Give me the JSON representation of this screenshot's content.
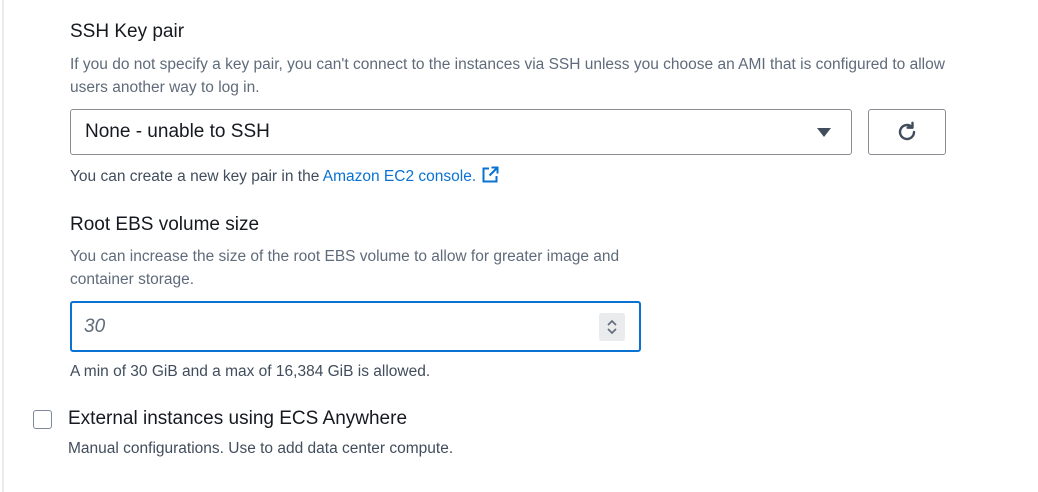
{
  "ssh_key_pair": {
    "label": "SSH Key pair",
    "description": "If you do not specify a key pair, you can't connect to the instances via SSH unless you choose an AMI that is configured to allow users another way to log in.",
    "selected_value": "None - unable to SSH",
    "hint_prefix": "You can create a new key pair in the ",
    "hint_link": "Amazon EC2 console.",
    "refresh_icon": "refresh-icon",
    "external_link_icon": "external-link-icon"
  },
  "root_ebs_volume": {
    "label": "Root EBS volume size",
    "description": "You can increase the size of the root EBS volume to allow for greater image and container storage.",
    "value": "30",
    "hint": "A min of 30 GiB and a max of 16,384 GiB is allowed."
  },
  "ecs_anywhere": {
    "label": "External instances using ECS Anywhere",
    "description": "Manual configurations. Use to add data center compute.",
    "checked": false
  },
  "colors": {
    "link": "#0972d3",
    "focus_border": "#0972d3",
    "text": "#16191f",
    "muted": "#5f6b7a"
  }
}
